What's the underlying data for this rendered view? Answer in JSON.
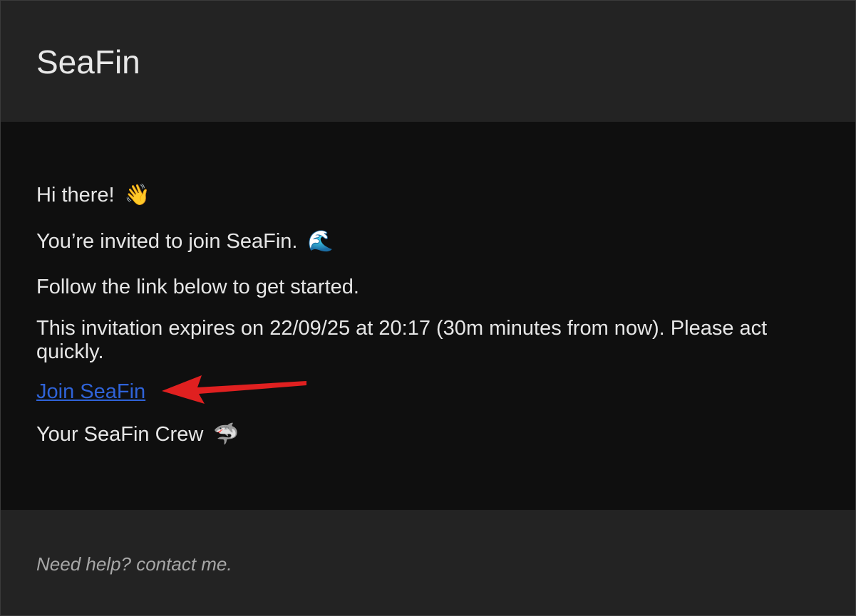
{
  "header": {
    "brand": "SeaFin"
  },
  "email": {
    "greeting": "Hi there!",
    "greeting_emoji": "👋",
    "invite": "You’re invited to join SeaFin.",
    "invite_emoji": "🌊",
    "instruction": "Follow the link below to get started.",
    "expiry": "This invitation expires on 22/09/25 at 20:17 (30m minutes from now). Please act quickly.",
    "join_link_label": "Join SeaFin",
    "signoff": "Your SeaFin Crew",
    "signoff_emoji": "🦈"
  },
  "footer": {
    "help_text": "Need help? contact me."
  },
  "annotation": {
    "arrow_color": "#e02020",
    "arrow_icon": "red-arrow-pointer-icon"
  },
  "colors": {
    "link": "#2f63d8",
    "header_bg": "#232323",
    "body_bg": "#0f0f0f",
    "text": "#e6e6e6"
  }
}
